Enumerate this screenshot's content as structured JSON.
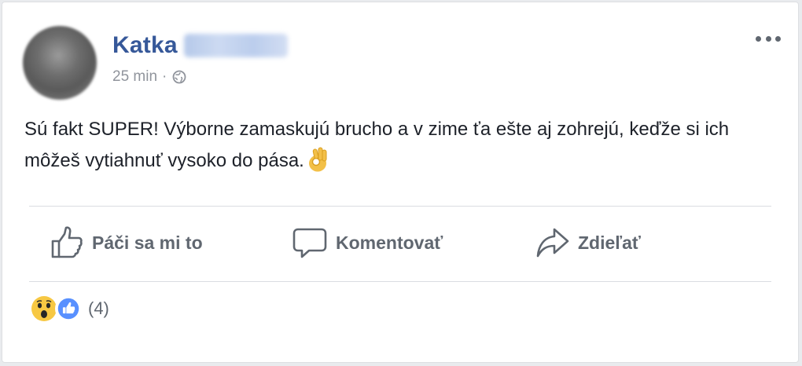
{
  "post": {
    "author": "Katka",
    "time": "25 min",
    "separator": "·",
    "text": "Sú fakt SUPER! Výborne zamaskujú brucho a v zime ťa ešte aj zohrejú, keďže si ich môžeš vytiahnuť vysoko do pása."
  },
  "actions": {
    "like": "Páči sa mi to",
    "comment": "Komentovať",
    "share": "Zdieľať"
  },
  "reactions": {
    "count": "(4)"
  },
  "colors": {
    "author": "#365899",
    "text": "#1d2129",
    "muted": "#606770",
    "like_blue": "#5890ff",
    "wow_yellow": "#f7c843"
  },
  "icons": [
    "globe-icon",
    "more-icon",
    "ok-hand-icon",
    "thumbs-up-icon",
    "comment-icon",
    "share-icon",
    "wow-reaction-icon",
    "like-reaction-icon"
  ]
}
